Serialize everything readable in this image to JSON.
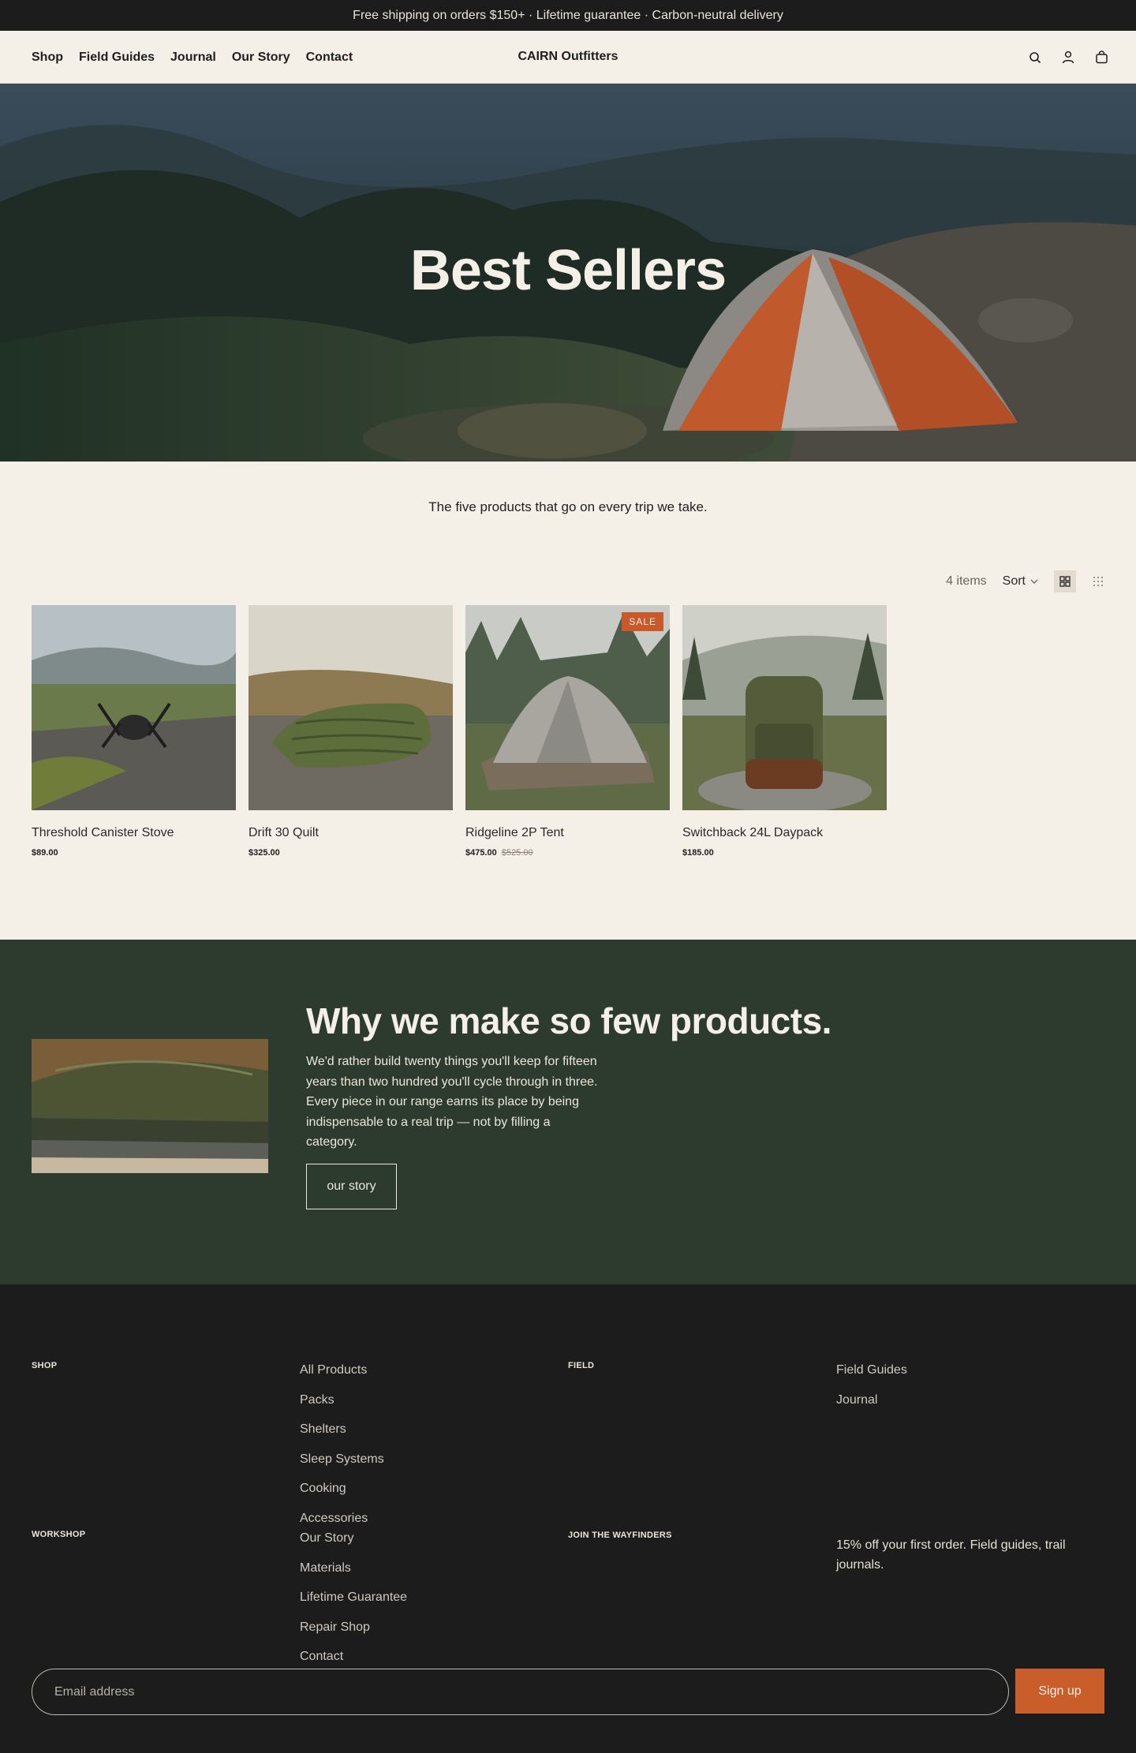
{
  "announcement": "Free shipping on orders $150+ · Lifetime guarantee · Carbon-neutral delivery",
  "header": {
    "nav": [
      "Shop",
      "Field Guides",
      "Journal",
      "Our Story",
      "Contact"
    ],
    "brand": "CAIRN Outfitters",
    "icons": [
      "search-icon",
      "account-icon",
      "bag-icon"
    ]
  },
  "hero": {
    "title": "Best Sellers"
  },
  "intro": "The five products that go on every trip we take.",
  "toolbar": {
    "count": "4 items",
    "sort_label": "Sort",
    "views": [
      "grid-view-icon",
      "dense-grid-view-icon"
    ]
  },
  "products": [
    {
      "name": "Threshold Canister Stove",
      "price": "$89.00",
      "compare": ""
    },
    {
      "name": "Drift 30 Quilt",
      "price": "$325.00",
      "compare": ""
    },
    {
      "name": "Ridgeline 2P Tent",
      "price": "$475.00",
      "compare": "$525.00",
      "badge": "SALE"
    },
    {
      "name": "Switchback 24L Daypack",
      "price": "$185.00",
      "compare": ""
    }
  ],
  "story": {
    "title": "Why we make so few products.",
    "body": "We'd rather build twenty things you'll keep for fifteen years than two hundred you'll cycle through in three. Every piece in our range earns its place by being indispensable to a real trip — not by filling a category.",
    "button": "our story"
  },
  "footer": {
    "shop": {
      "heading": "SHOP",
      "links": [
        "All Products",
        "Packs",
        "Shelters",
        "Sleep Systems",
        "Cooking",
        "Accessories"
      ]
    },
    "field": {
      "heading": "FIELD",
      "links": [
        "Field Guides",
        "Journal"
      ]
    },
    "workshop": {
      "heading": "WORKSHOP",
      "links": [
        "Our Story",
        "Materials",
        "Lifetime Guarantee",
        "Repair Shop",
        "Contact"
      ]
    },
    "newsletter": {
      "heading": "JOIN THE WAYFINDERS",
      "text": "15% off your first order. Field guides, trail journals.",
      "placeholder": "Email address",
      "button": "Sign up"
    }
  },
  "colors": {
    "accent": "#c95e2b",
    "forest": "#2c3b2d",
    "cream": "#f4efe7",
    "ink": "#1c1c1c"
  }
}
